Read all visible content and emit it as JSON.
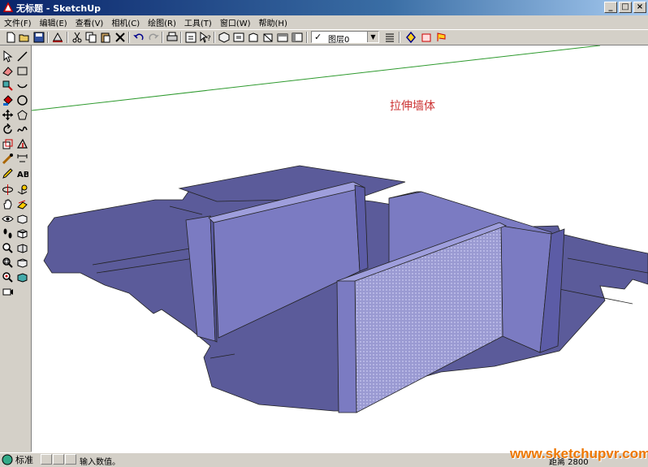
{
  "window": {
    "title": "无标题 - SketchUp",
    "min_label": "_",
    "max_label": "□",
    "close_label": "×"
  },
  "menubar": {
    "items": [
      "文件(F)",
      "编辑(E)",
      "查看(V)",
      "相机(C)",
      "绘图(R)",
      "工具(T)",
      "窗口(W)",
      "帮助(H)"
    ]
  },
  "toolbar": {
    "layer": {
      "check": "✓",
      "selected": "图层0"
    }
  },
  "canvas": {
    "note": "拉伸墙体",
    "wall_color": "#7b7bc2",
    "floor_color": "#5b5b9a",
    "horizon_color": "#2e9a2e"
  },
  "statusbar": {
    "mode": "标准",
    "prompt": "输入数值。",
    "measurement": "距离 2800"
  },
  "watermark": "www.sketchupvr.com"
}
